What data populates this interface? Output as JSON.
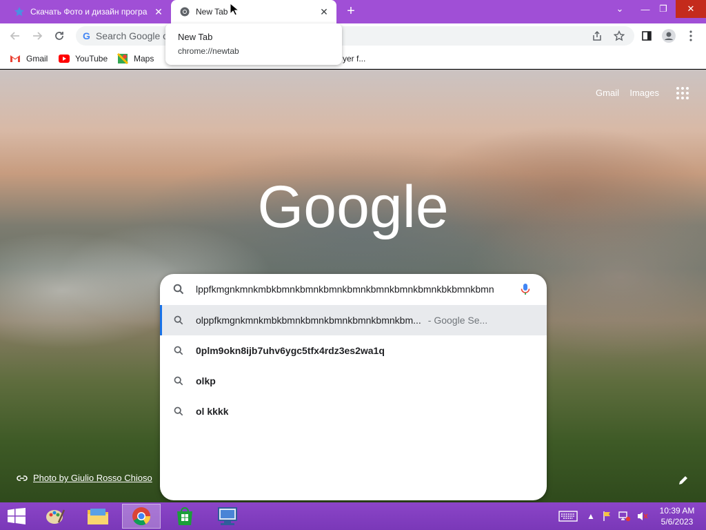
{
  "tabs": [
    {
      "title": "Скачать Фото и дизайн програ",
      "active": false
    },
    {
      "title": "New Tab",
      "active": true
    }
  ],
  "toolbar": {
    "omnibox_text": "Search Google o"
  },
  "tooltip": {
    "title": "New Tab",
    "url": "chrome://newtab"
  },
  "bookmarks": [
    {
      "label": "Gmail",
      "icon": "gmail-icon"
    },
    {
      "label": "YouTube",
      "icon": "youtube-icon"
    },
    {
      "label": "Maps",
      "icon": "maps-icon"
    },
    {
      "label": "yer f...",
      "icon": ""
    }
  ],
  "ntp": {
    "gmail_link": "Gmail",
    "images_link": "Images",
    "logo_text": "Google",
    "search_value": "lppfkmgnkmnkmbkbmnkbmnkbmnkbmnkbmnkbmnkbmnkbkbmnkbmn",
    "suggestions": [
      {
        "text": "olppfkmgnkmnkmbkbmnkbmnkbmnkbmnkbmnkbm...",
        "suffix": "- Google Se...",
        "selected": true
      },
      {
        "text": "0plm9okn8ijb7uhv6ygc5tfx4rdz3es2wa1q",
        "suffix": "",
        "selected": false
      },
      {
        "text": "olkp",
        "suffix": "",
        "selected": false
      },
      {
        "text": "ol kkkk",
        "suffix": "",
        "selected": false
      }
    ],
    "photo_credit": "Photo by Giulio Rosso Chioso"
  },
  "taskbar": {
    "time": "10:39 AM",
    "date": "5/6/2023"
  },
  "colors": {
    "tabstrip": "#a04fd6",
    "taskbar": "#7a38b8",
    "selection_accent": "#1a73e8"
  }
}
